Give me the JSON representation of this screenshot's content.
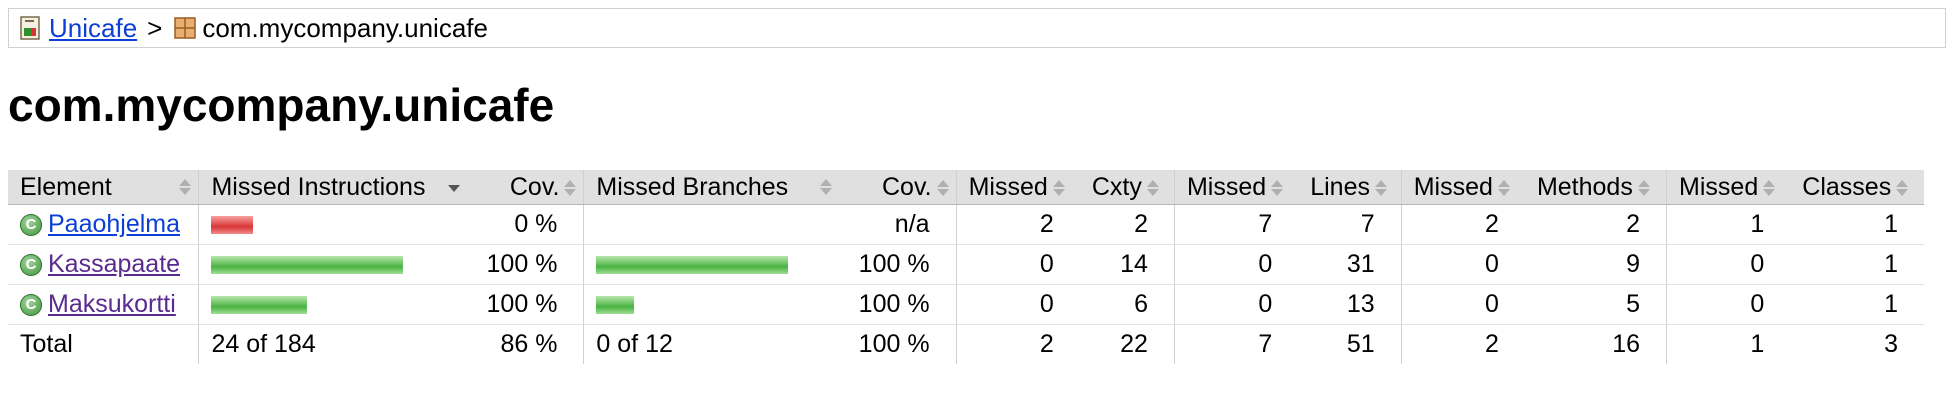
{
  "breadcrumb": {
    "root_label": "Unicafe",
    "separator": ">",
    "current_label": "com.mycompany.unicafe"
  },
  "page_title": "com.mycompany.unicafe",
  "table": {
    "headers": {
      "element": "Element",
      "missed_instructions": "Missed Instructions",
      "cov1": "Cov.",
      "missed_branches": "Missed Branches",
      "cov2": "Cov.",
      "missed_cxty": "Missed",
      "cxty": "Cxty",
      "missed_lines": "Missed",
      "lines": "Lines",
      "missed_methods": "Missed",
      "methods": "Methods",
      "missed_classes": "Missed",
      "classes": "Classes"
    },
    "rows": [
      {
        "name": "Paaohjelma",
        "instr_missed_fraction": 1.0,
        "instr_covered_fraction": 0.0,
        "instr_cov": "0 %",
        "branch_covered_fraction": 0,
        "branch_cov": "n/a",
        "missed_cxty": "2",
        "cxty": "2",
        "missed_lines": "7",
        "lines": "7",
        "missed_methods": "2",
        "methods": "2",
        "missed_classes": "1",
        "classes": "1"
      },
      {
        "name": "Kassapaate",
        "instr_missed_fraction": 0.0,
        "instr_covered_fraction": 1.0,
        "instr_cov": "100 %",
        "branch_covered_fraction": 1.0,
        "branch_cov": "100 %",
        "missed_cxty": "0",
        "cxty": "14",
        "missed_lines": "0",
        "lines": "31",
        "missed_methods": "0",
        "methods": "9",
        "missed_classes": "0",
        "classes": "1"
      },
      {
        "name": "Maksukortti",
        "instr_missed_fraction": 0.0,
        "instr_covered_fraction": 1.0,
        "instr_cov": "100 %",
        "branch_covered_fraction": 1.0,
        "branch_cov": "100 %",
        "missed_cxty": "0",
        "cxty": "6",
        "missed_lines": "0",
        "lines": "13",
        "missed_methods": "0",
        "methods": "5",
        "missed_classes": "0",
        "classes": "1"
      }
    ],
    "total": {
      "label": "Total",
      "instructions": "24 of 184",
      "instr_cov": "86 %",
      "branches": "0 of 12",
      "branch_cov": "100 %",
      "missed_cxty": "2",
      "cxty": "22",
      "missed_lines": "7",
      "lines": "51",
      "missed_methods": "2",
      "methods": "16",
      "missed_classes": "1",
      "classes": "3"
    }
  },
  "colors": {
    "link": "#0b3fd6",
    "visited_link": "#5a2a8f",
    "header_bg": "#e0e0e0",
    "bar_red": "#d93636",
    "bar_green": "#49b340"
  }
}
